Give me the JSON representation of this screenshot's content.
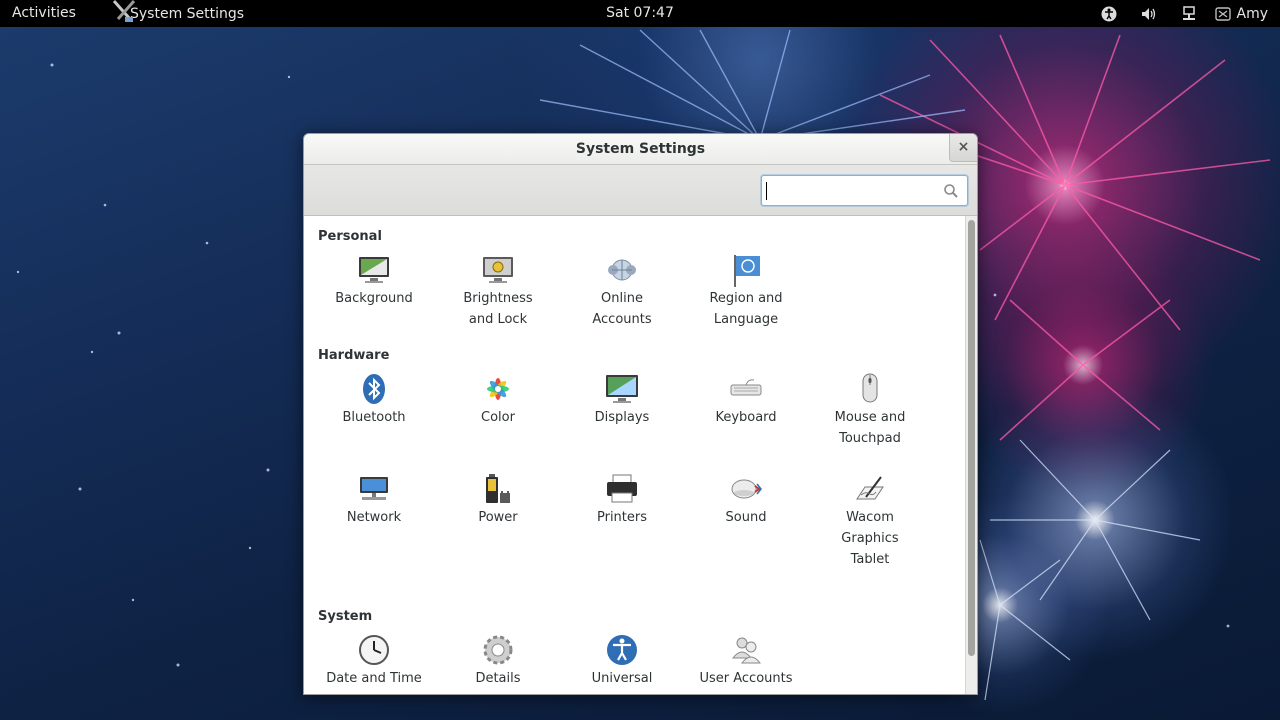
{
  "panel": {
    "activities": "Activities",
    "app_name": "System Settings",
    "clock": "Sat 07:47",
    "user": "Amy",
    "indicators": [
      "accessibility-icon",
      "volume-icon",
      "network-icon",
      "user-status-icon"
    ]
  },
  "window": {
    "title": "System Settings",
    "close_glyph": "×",
    "search": {
      "value": "",
      "placeholder": ""
    }
  },
  "sections": {
    "personal": {
      "title": "Personal",
      "items": [
        {
          "label_1": "Background",
          "label_2": "",
          "icon": "background-icon"
        },
        {
          "label_1": "Brightness",
          "label_2": "and Lock",
          "icon": "brightness-lock-icon"
        },
        {
          "label_1": "Online",
          "label_2": "Accounts",
          "icon": "online-accounts-icon"
        },
        {
          "label_1": "Region and",
          "label_2": "Language",
          "icon": "region-flag-icon"
        }
      ]
    },
    "hardware": {
      "title": "Hardware",
      "items": [
        {
          "label_1": "Bluetooth",
          "label_2": "",
          "icon": "bluetooth-icon"
        },
        {
          "label_1": "Color",
          "label_2": "",
          "icon": "color-icon"
        },
        {
          "label_1": "Displays",
          "label_2": "",
          "icon": "displays-icon"
        },
        {
          "label_1": "Keyboard",
          "label_2": "",
          "icon": "keyboard-icon"
        },
        {
          "label_1": "Mouse and",
          "label_2": "Touchpad",
          "icon": "mouse-icon"
        },
        {
          "label_1": "Network",
          "label_2": "",
          "icon": "network-icon"
        },
        {
          "label_1": "Power",
          "label_2": "",
          "icon": "power-battery-icon"
        },
        {
          "label_1": "Printers",
          "label_2": "",
          "icon": "printer-icon"
        },
        {
          "label_1": "Sound",
          "label_2": "",
          "icon": "sound-icon"
        },
        {
          "label_1": "Wacom",
          "label_2": "Graphics",
          "label_3": "Tablet",
          "icon": "wacom-tablet-icon"
        }
      ]
    },
    "system": {
      "title": "System",
      "items": [
        {
          "label_1": "Date and Time",
          "label_2": "",
          "icon": "clock-icon"
        },
        {
          "label_1": "Details",
          "label_2": "",
          "icon": "details-gear-icon"
        },
        {
          "label_1": "Universal",
          "label_2": "",
          "icon": "universal-access-icon"
        },
        {
          "label_1": "User Accounts",
          "label_2": "",
          "icon": "user-accounts-icon"
        }
      ]
    }
  },
  "colors": {
    "panel_bg": "#000000",
    "desktop_blue": "#142c56",
    "firework_pink": "#e6288a",
    "accent_blue": "#4a90d9"
  }
}
